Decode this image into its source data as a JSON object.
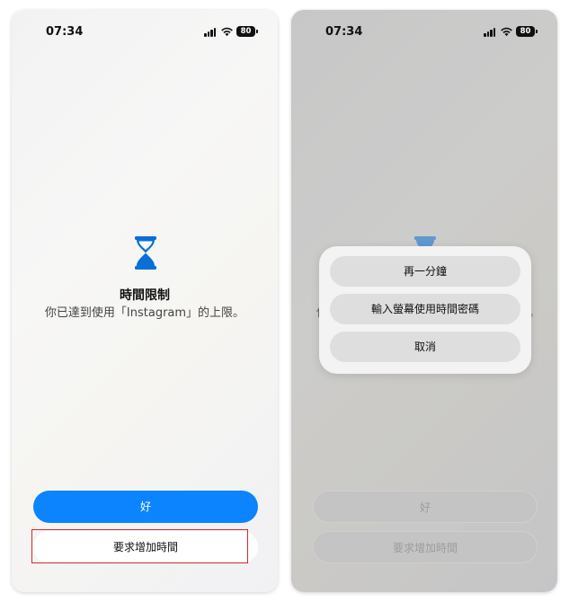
{
  "status": {
    "time": "07:34",
    "battery": "80"
  },
  "screen": {
    "title": "時間限制",
    "message": "你已達到使用「Instagram」的上限。",
    "ok_label": "好",
    "request_more_label": "要求增加時間"
  },
  "action_sheet": {
    "one_more_minute": "再一分鐘",
    "enter_passcode": "輸入螢幕使用時間密碼",
    "cancel": "取消"
  },
  "colors": {
    "accent": "#0b84fe",
    "icon": "#0a6fd6",
    "highlight": "#d6262a"
  },
  "icons": {
    "hourglass": "hourglass-icon",
    "signal": "signal-icon",
    "wifi": "wifi-icon",
    "battery": "battery-icon"
  }
}
